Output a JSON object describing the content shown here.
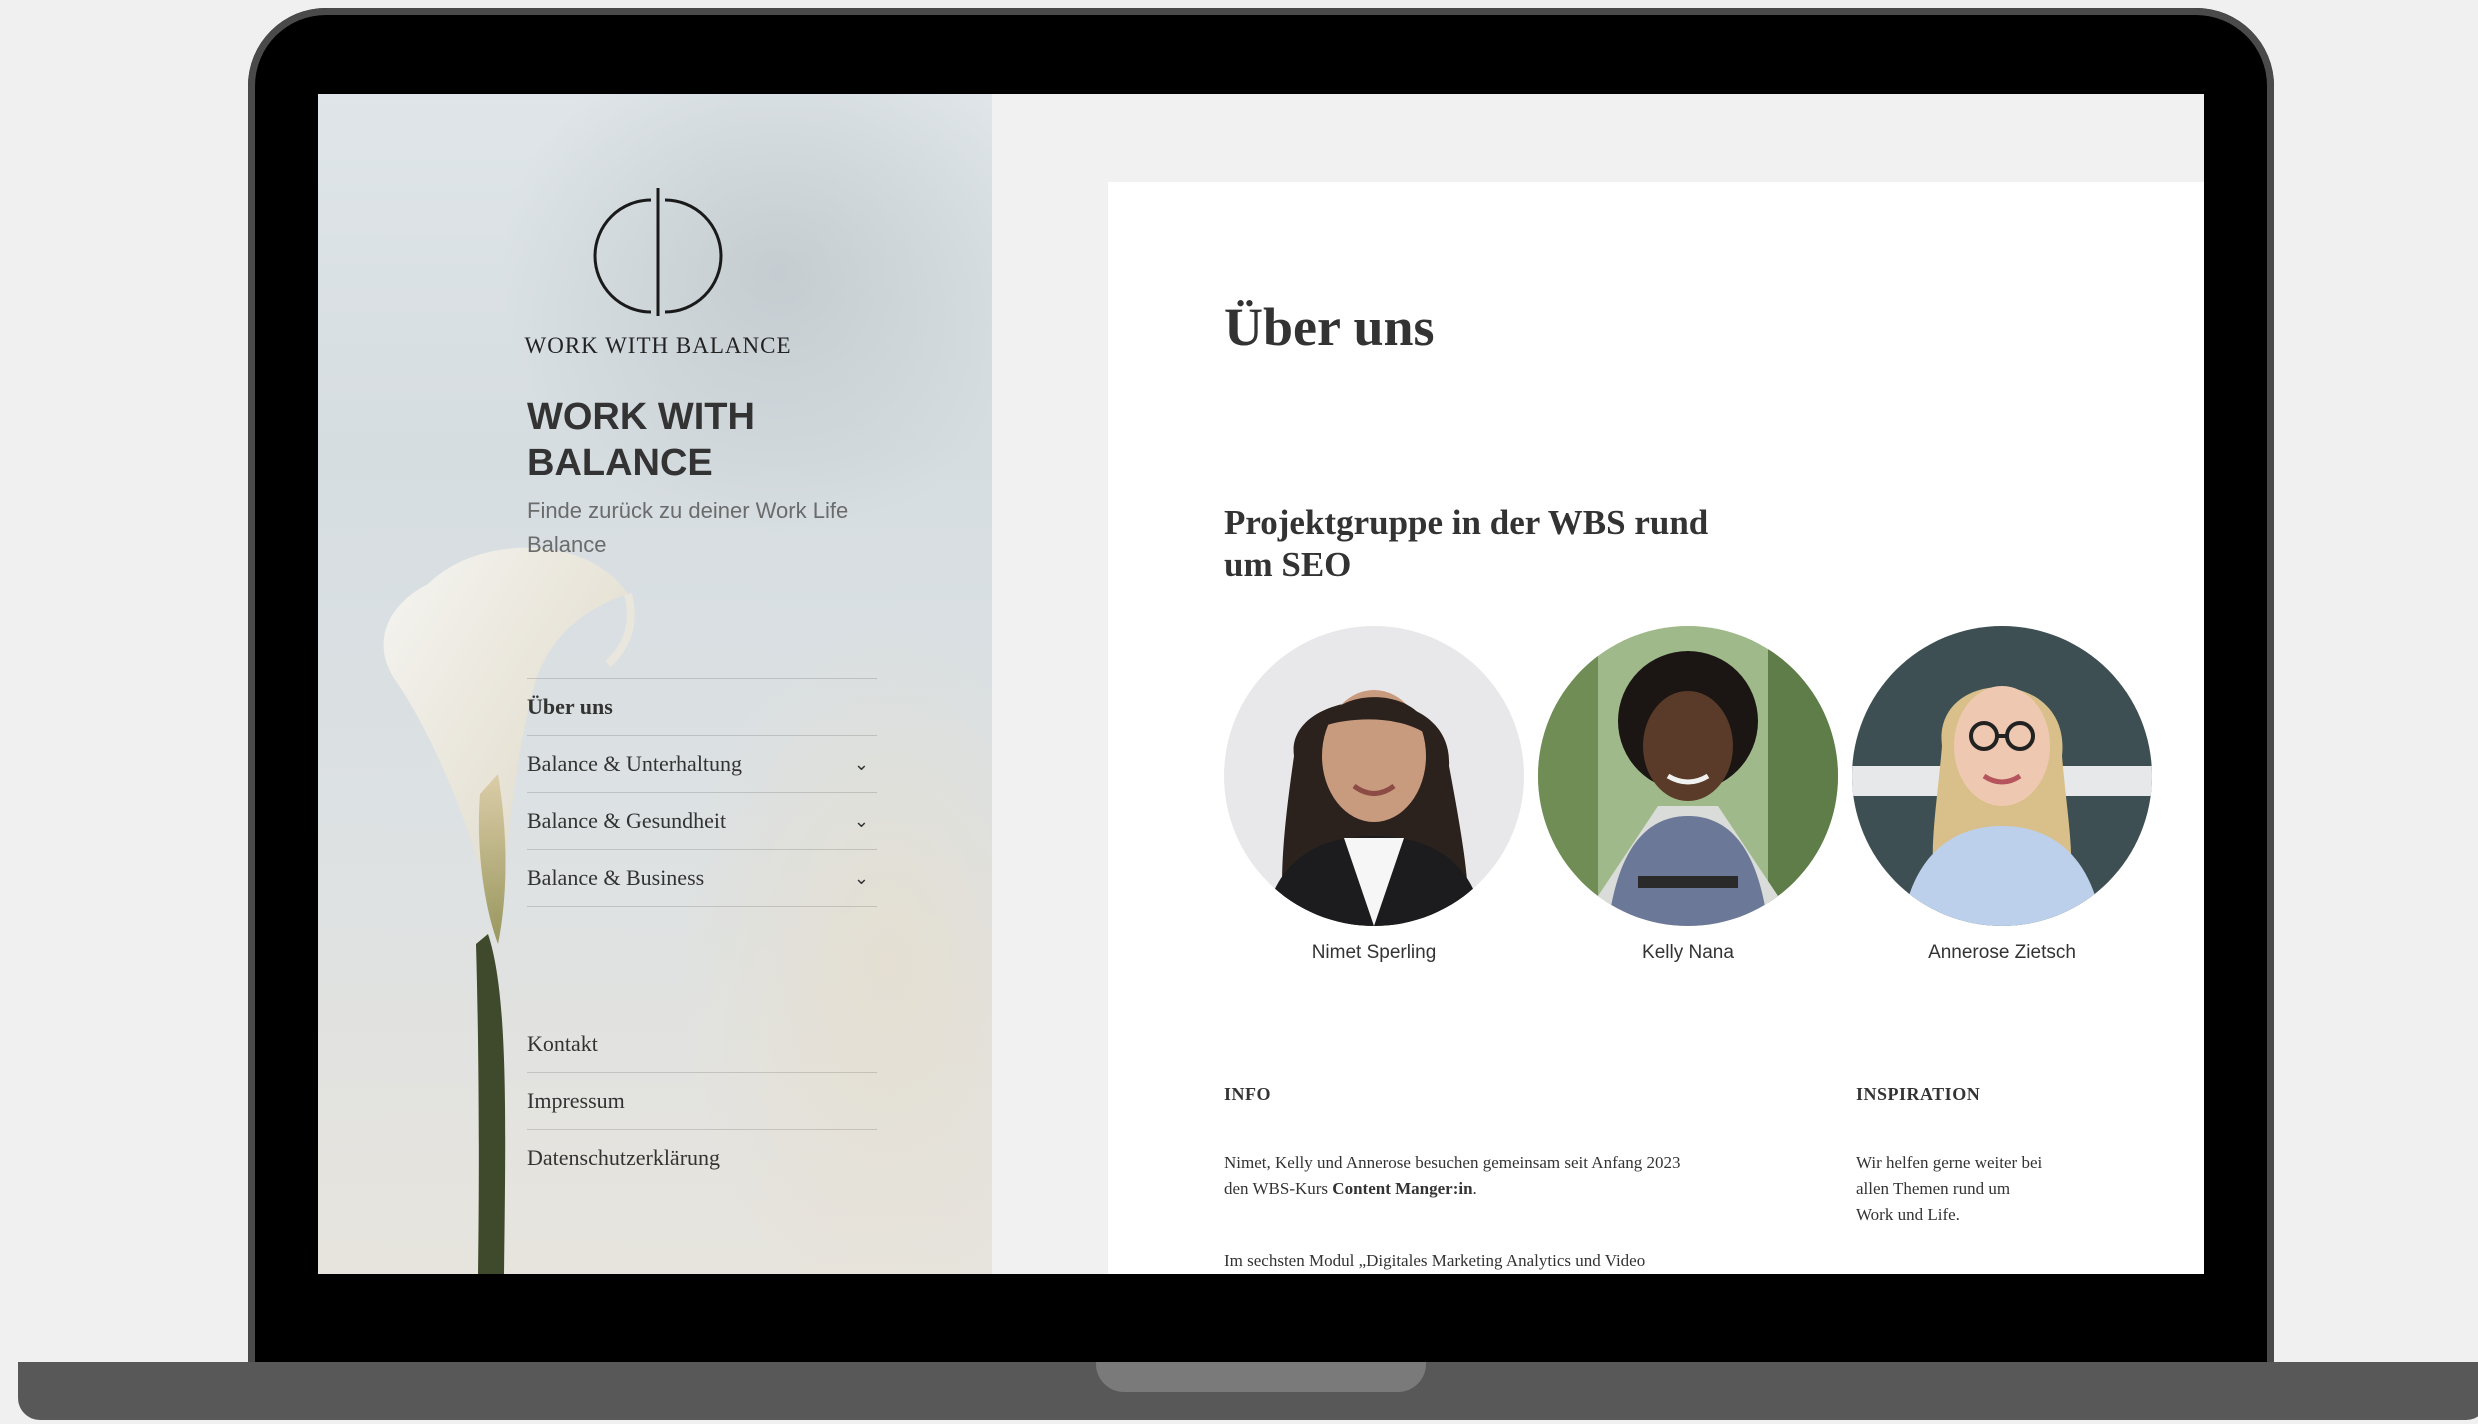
{
  "site": {
    "logo_text": "WORK WITH BALANCE",
    "title": "WORK WITH BALANCE",
    "description": "Finde zurück zu deiner Work Life Balance"
  },
  "nav": {
    "items": [
      {
        "label": "Über uns",
        "active": true
      },
      {
        "label": "Balance & Unterhaltung",
        "has_submenu": true
      },
      {
        "label": "Balance & Gesundheit",
        "has_submenu": true
      },
      {
        "label": "Balance & Business",
        "has_submenu": true
      }
    ]
  },
  "social": {
    "items": [
      {
        "label": "Kontakt"
      },
      {
        "label": "Impressum"
      },
      {
        "label": "Datenschutzerklärung"
      }
    ]
  },
  "main": {
    "page_title": "Über uns",
    "subtitle": "Projektgruppe in der WBS rund um SEO",
    "team": [
      {
        "name": "Nimet Sperling"
      },
      {
        "name": "Kelly Nana"
      },
      {
        "name": "Annerose Zietsch"
      }
    ],
    "info": {
      "heading": "INFO",
      "paragraph1_part1": "Nimet, Kelly und Annerose besuchen gemeinsam seit Anfang 2023 den WBS-Kurs ",
      "paragraph1_bold": "Content Manger:in",
      "paragraph1_end": ".",
      "paragraph2": "Im sechsten Modul „Digitales Marketing Analytics und Video"
    },
    "inspiration": {
      "heading": "INSPIRATION",
      "text": "Wir helfen gerne weiter bei allen Themen rund um Work und Life."
    }
  },
  "colors": {
    "text": "#333333",
    "muted": "#6b6b6b",
    "background": "#f1f1f1",
    "laptop_frame": "#000000",
    "laptop_base": "#585858"
  }
}
